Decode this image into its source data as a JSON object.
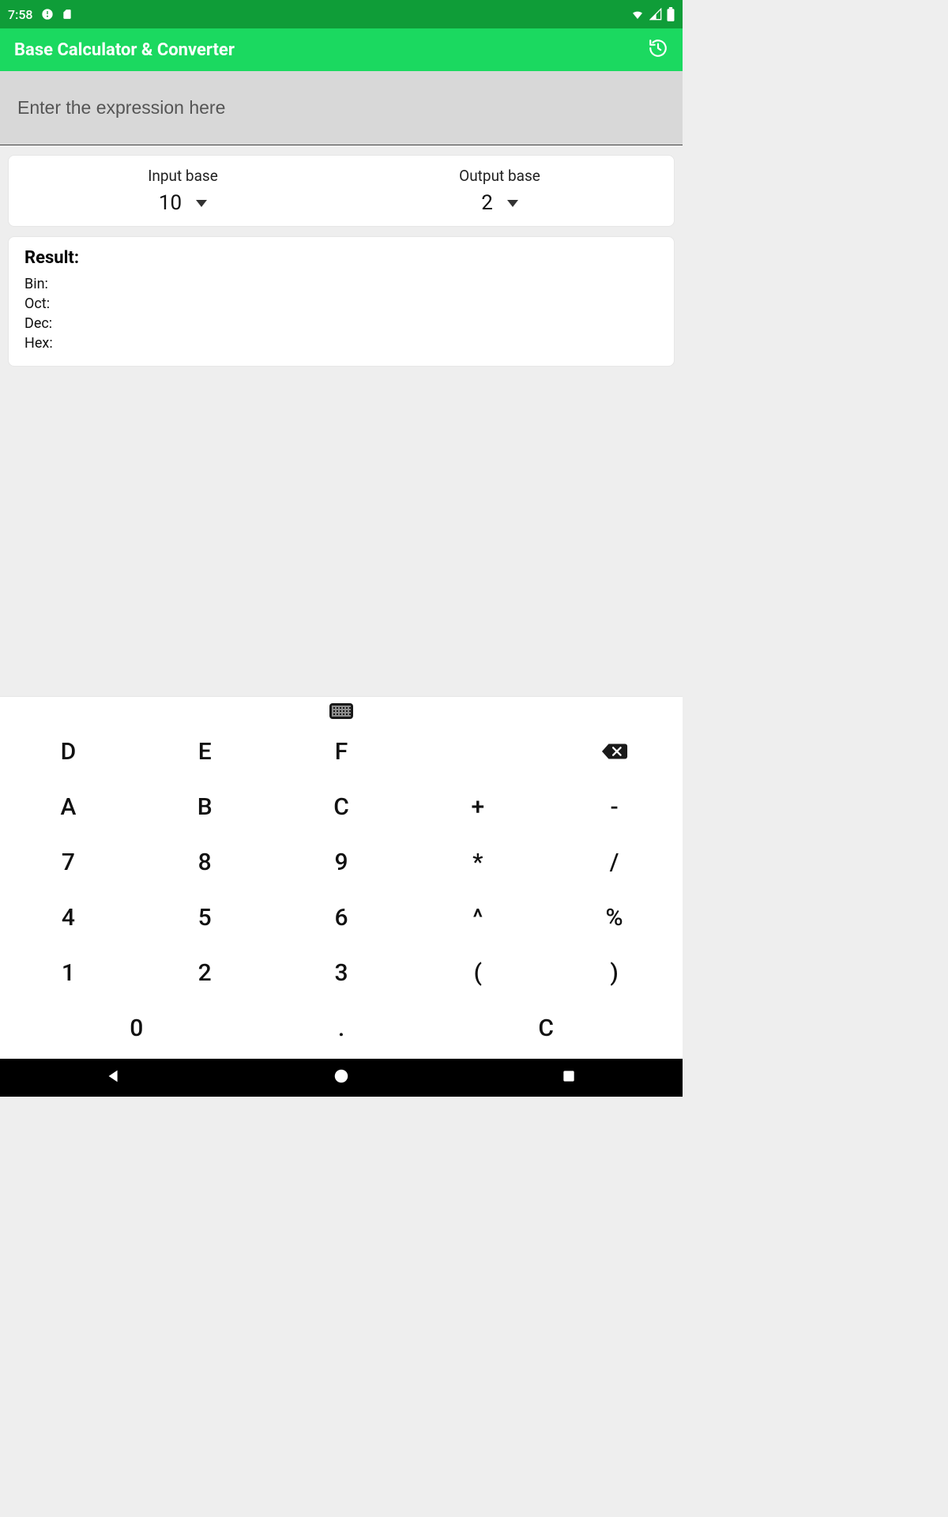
{
  "status": {
    "time": "7:58"
  },
  "header": {
    "title": "Base Calculator & Converter"
  },
  "input": {
    "placeholder": "Enter the expression here",
    "value": ""
  },
  "bases": {
    "input_label": "Input base",
    "input_value": "10",
    "output_label": "Output base",
    "output_value": "2"
  },
  "result": {
    "title": "Result:",
    "rows": [
      {
        "label": "Bin:",
        "value": ""
      },
      {
        "label": "Oct:",
        "value": ""
      },
      {
        "label": "Dec:",
        "value": ""
      },
      {
        "label": "Hex:",
        "value": ""
      }
    ]
  },
  "keypad": {
    "rows": [
      [
        "D",
        "E",
        "F",
        "",
        "__BKSP__"
      ],
      [
        "A",
        "B",
        "C",
        "+",
        "-"
      ],
      [
        "7",
        "8",
        "9",
        "*",
        "/"
      ],
      [
        "4",
        "5",
        "6",
        "^",
        "%"
      ],
      [
        "1",
        "2",
        "3",
        "(",
        ")"
      ]
    ],
    "wide": [
      "0",
      ".",
      "C"
    ]
  }
}
